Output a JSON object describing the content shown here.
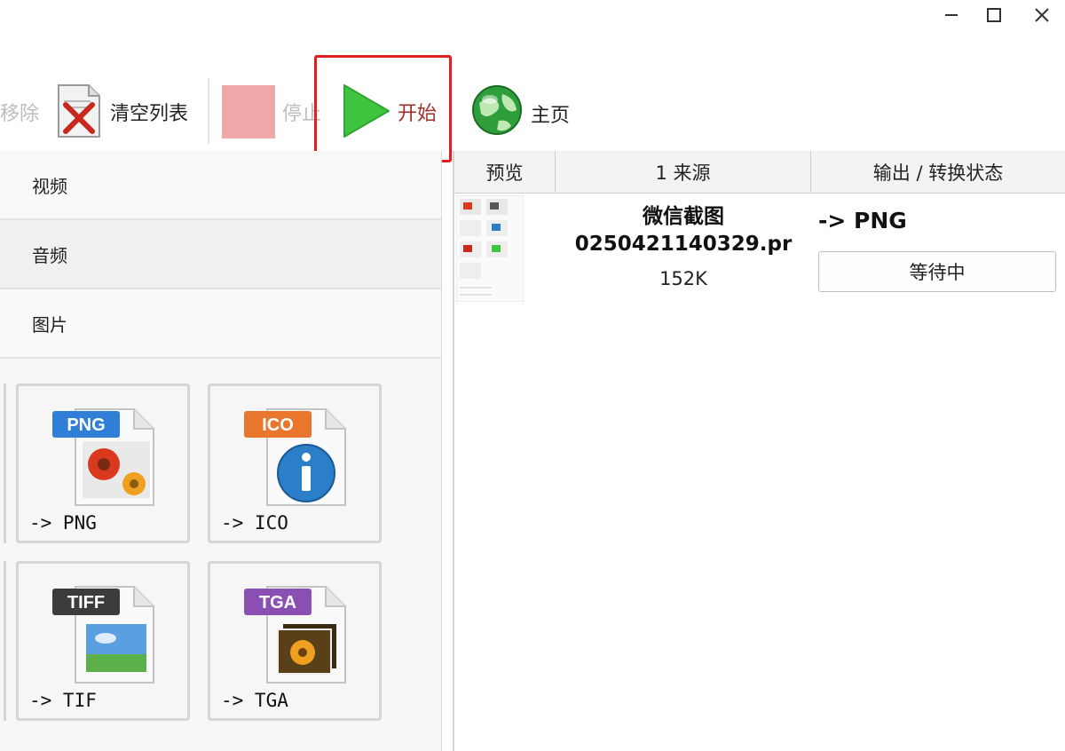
{
  "window": {
    "icons": [
      "minimize-icon",
      "maximize-icon",
      "close-icon"
    ]
  },
  "toolbar": {
    "remove_label": "移除",
    "clear_label": "清空列表",
    "stop_label": "停止",
    "start_label": "开始",
    "home_label": "主页",
    "highlight_color": "#e02020",
    "start_icon_color": "#3ec43e"
  },
  "categories": [
    {
      "label": "视频"
    },
    {
      "label": "音频"
    },
    {
      "label": "图片"
    }
  ],
  "formats": [
    {
      "badge": "PNG",
      "label": "-> PNG",
      "badge_color": "#2f7fd6"
    },
    {
      "badge": "ICO",
      "label": "-> ICO",
      "badge_color": "#e8762d"
    },
    {
      "badge": "TIFF",
      "label": "-> TIF",
      "badge_color": "#3c3c3c"
    },
    {
      "badge": "TGA",
      "label": "-> TGA",
      "badge_color": "#8a4fb3"
    }
  ],
  "table": {
    "headers": [
      "预览",
      "1 来源",
      "输出 / 转换状态"
    ],
    "rows": [
      {
        "name_line1": "微信截图",
        "name_line2": "0250421140329.pr",
        "size": "152K",
        "output": "-> PNG",
        "status": "等待中"
      }
    ]
  }
}
